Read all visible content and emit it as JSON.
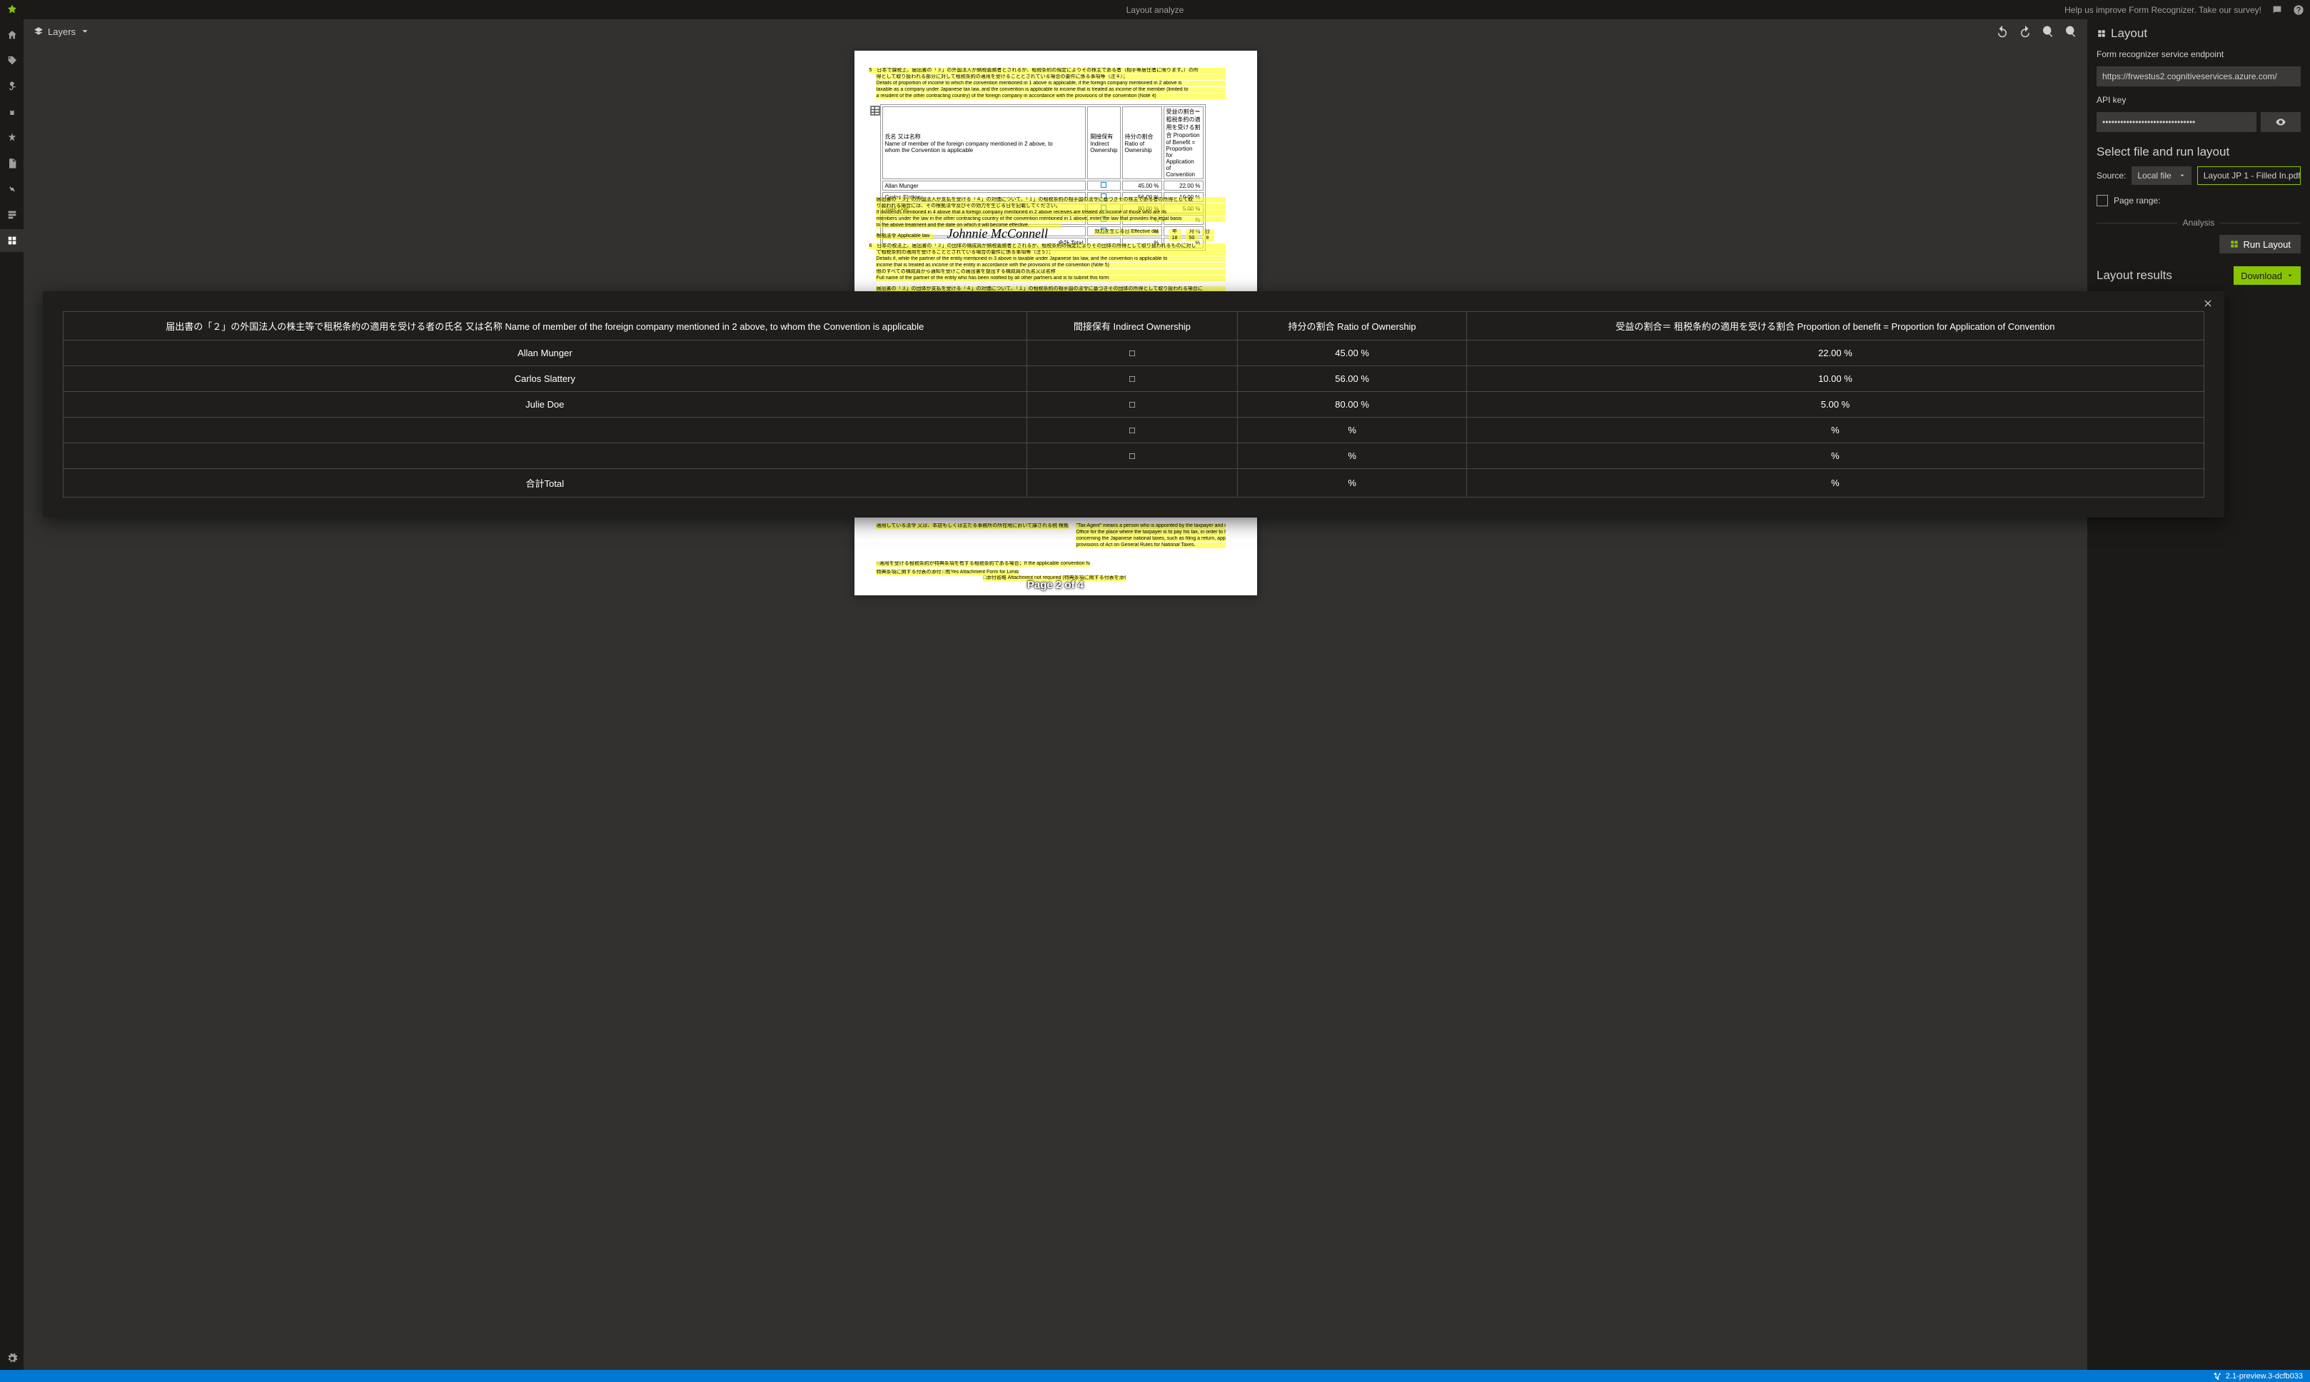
{
  "topbar": {
    "title": "Layout analyze",
    "survey": "Help us improve Form Recognizer. Take our survey!"
  },
  "canvas": {
    "layers_label": "Layers",
    "page_indicator": "Page 2 of 4",
    "form_table": {
      "headers": [
        "氏名 又は名称 Name of member of the foreign company mentioned in 2 above, to whom the Convention is applicable",
        "間接保有 Indirect Ownership",
        "持分の割合 Ratio of Ownership",
        "受益の割合 Proportion of Benefit = Proportion for Application of Convention"
      ],
      "rows": [
        {
          "name": "Allan Munger",
          "ratio": "45.00 %",
          "benefit": "22.00 %"
        },
        {
          "name": "Carlos Slattery",
          "ratio": "56.00 %",
          "benefit": "10.00 %"
        },
        {
          "name": "Julie Doe",
          "ratio": "80.00 %",
          "benefit": "5.00 %"
        }
      ],
      "total_label": "合計 Total"
    },
    "signature": "Johnnie McConnell"
  },
  "right": {
    "panel_title": "Layout",
    "endpoint_label": "Form recognizer service endpoint",
    "endpoint_value": "https://frwestus2.cognitiveservices.azure.com/",
    "apikey_label": "API key",
    "apikey_masked": "•••••••••••••••••••••••••••••••",
    "select_heading": "Select file and run layout",
    "source_label": "Source:",
    "source_value": "Local file",
    "file_name": "Layout JP 1 - Filled In.pdf",
    "page_range_label": "Page range:",
    "analysis_label": "Analysis",
    "run_label": "Run Layout",
    "results_heading": "Layout results",
    "download_label": "Download"
  },
  "modal": {
    "headers": {
      "name": "届出書の「２」の外国法人の株主等で租税条約の適用を受ける者の氏名 又は名称 Name of member of the foreign company mentioned in 2 above, to whom the Convention is applicable",
      "indirect": "間接保有 Indirect Ownership",
      "ratio": "持分の割合 Ratio of Ownership",
      "benefit": "受益の割合＝ 租税条約の適用を受ける割合 Proportion of benefit = Proportion for Application of Convention"
    },
    "rows": [
      {
        "name": "Allan Munger",
        "indirect": "□",
        "ratio": "45.00 %",
        "benefit": "22.00 %"
      },
      {
        "name": "Carlos Slattery",
        "indirect": "□",
        "ratio": "56.00 %",
        "benefit": "10.00 %"
      },
      {
        "name": "Julie Doe",
        "indirect": "□",
        "ratio": "80.00 %",
        "benefit": "5.00 %"
      },
      {
        "name": "",
        "indirect": "□",
        "ratio": "%",
        "benefit": "%"
      },
      {
        "name": "",
        "indirect": "□",
        "ratio": "%",
        "benefit": "%"
      },
      {
        "name": "合計Total",
        "indirect": "",
        "ratio": "%",
        "benefit": "%"
      }
    ]
  },
  "status": {
    "version": "2.1-preview.3-dcfb033"
  }
}
